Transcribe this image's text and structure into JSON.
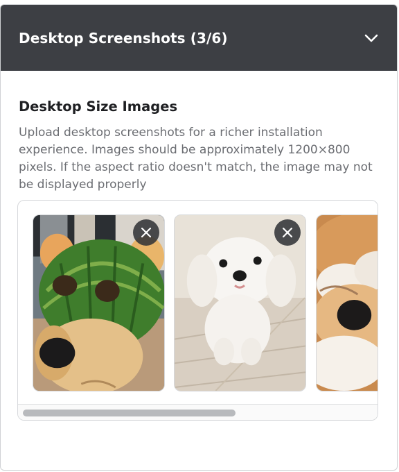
{
  "header": {
    "title": "Desktop Screenshots (3/6)",
    "toggle_icon": "chevron-down-icon"
  },
  "section": {
    "title": "Desktop Size Images",
    "description": "Upload desktop screenshots for a richer installation experience. Images should be approximately 1200×800 pixels. If the aspect ratio doesn't match, the image may not be displayed properly"
  },
  "gallery": {
    "items": [
      {
        "subject": "dog wearing a watermelon helmet",
        "removable": true,
        "remove_icon": "close-icon"
      },
      {
        "subject": "white fluffy puppy sitting on wooden floor",
        "removable": true,
        "remove_icon": "close-icon"
      },
      {
        "subject": "shiba dog covering face with paws",
        "removable": false
      }
    ],
    "scroll_position": 0
  },
  "colors": {
    "header_bg": "#3d3f44",
    "remove_button_bg": "#323438"
  }
}
